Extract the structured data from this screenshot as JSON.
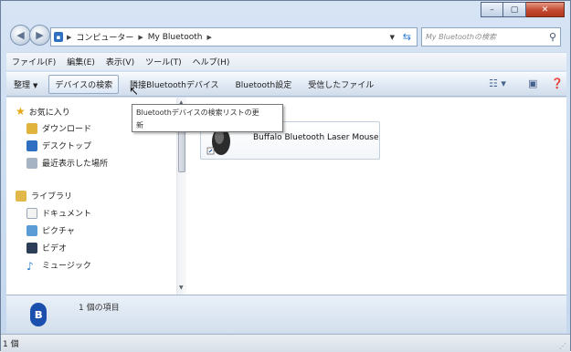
{
  "window": {
    "caption_buttons": [
      {
        "icon": "minimize-icon",
        "glyph": "–"
      },
      {
        "icon": "maximize-icon",
        "glyph": "▢"
      },
      {
        "icon": "close-icon",
        "glyph": "✕"
      }
    ]
  },
  "address": {
    "crumbs": [
      "コンピューター",
      "My Bluetooth"
    ],
    "search_placeholder": "My Bluetoothの検索"
  },
  "menubar": {
    "items": [
      "ファイル(F)",
      "編集(E)",
      "表示(V)",
      "ツール(T)",
      "ヘルプ(H)"
    ]
  },
  "commandbar": {
    "organize": "整理",
    "search_devices": "デバイスの検索",
    "nearby_devices": "隣接Bluetoothデバイス",
    "bluetooth_settings": "Bluetooth設定",
    "received_files": "受信したファイル"
  },
  "tooltip": {
    "line1": "Bluetoothデバイスの検索リストの更",
    "line2": "新"
  },
  "navpane": {
    "favorites_label": "お気に入り",
    "favorites": [
      "ダウンロード",
      "デスクトップ",
      "最近表示した場所"
    ],
    "libraries_label": "ライブラリ",
    "libraries": [
      "ドキュメント",
      "ピクチャ",
      "ビデオ",
      "ミュージック"
    ]
  },
  "filepane": {
    "device_name": "Buffalo Bluetooth Laser Mouse"
  },
  "details": {
    "item_count_text": "1 個の項目"
  },
  "statusbar": {
    "text": "1 個"
  },
  "colors": {
    "accent": "#1b4fae",
    "chrome": "#c4d7ee",
    "close_button": "#c24a30"
  }
}
